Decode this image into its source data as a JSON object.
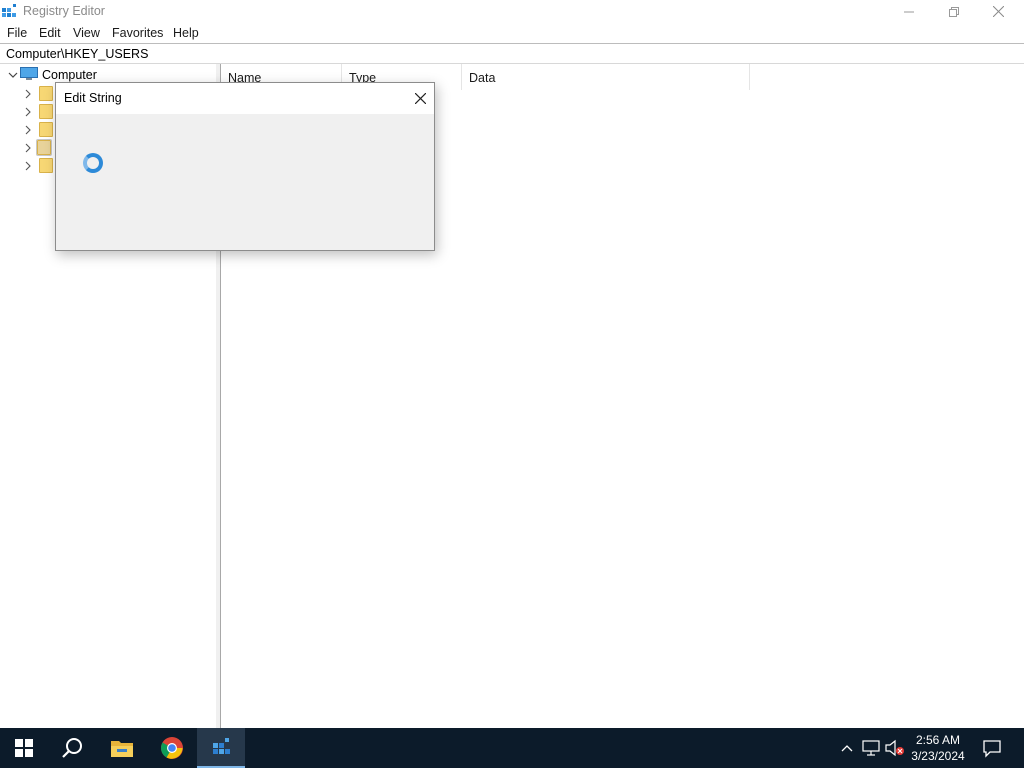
{
  "window": {
    "title": "Registry Editor",
    "controls": [
      "minimize",
      "restore",
      "close"
    ]
  },
  "menu": {
    "items": [
      "File",
      "Edit",
      "View",
      "Favorites",
      "Help"
    ]
  },
  "address": {
    "path": "Computer\\HKEY_USERS"
  },
  "tree": {
    "root_label": "Computer",
    "child_count_visible": 5
  },
  "list": {
    "columns": [
      "Name",
      "Type",
      "Data"
    ]
  },
  "dialog": {
    "title": "Edit String",
    "state": "loading"
  },
  "taskbar": {
    "items": [
      "start-button",
      "search-button",
      "file-explorer",
      "chrome",
      "registry-editor"
    ],
    "active": "registry-editor",
    "time": "2:56 AM",
    "date": "3/23/2024"
  },
  "colors": {
    "accent": "#2d8ad8",
    "taskbar": "#0c1b2a",
    "dialog_bg": "#f0f0f0",
    "folder": "#f7d774"
  }
}
